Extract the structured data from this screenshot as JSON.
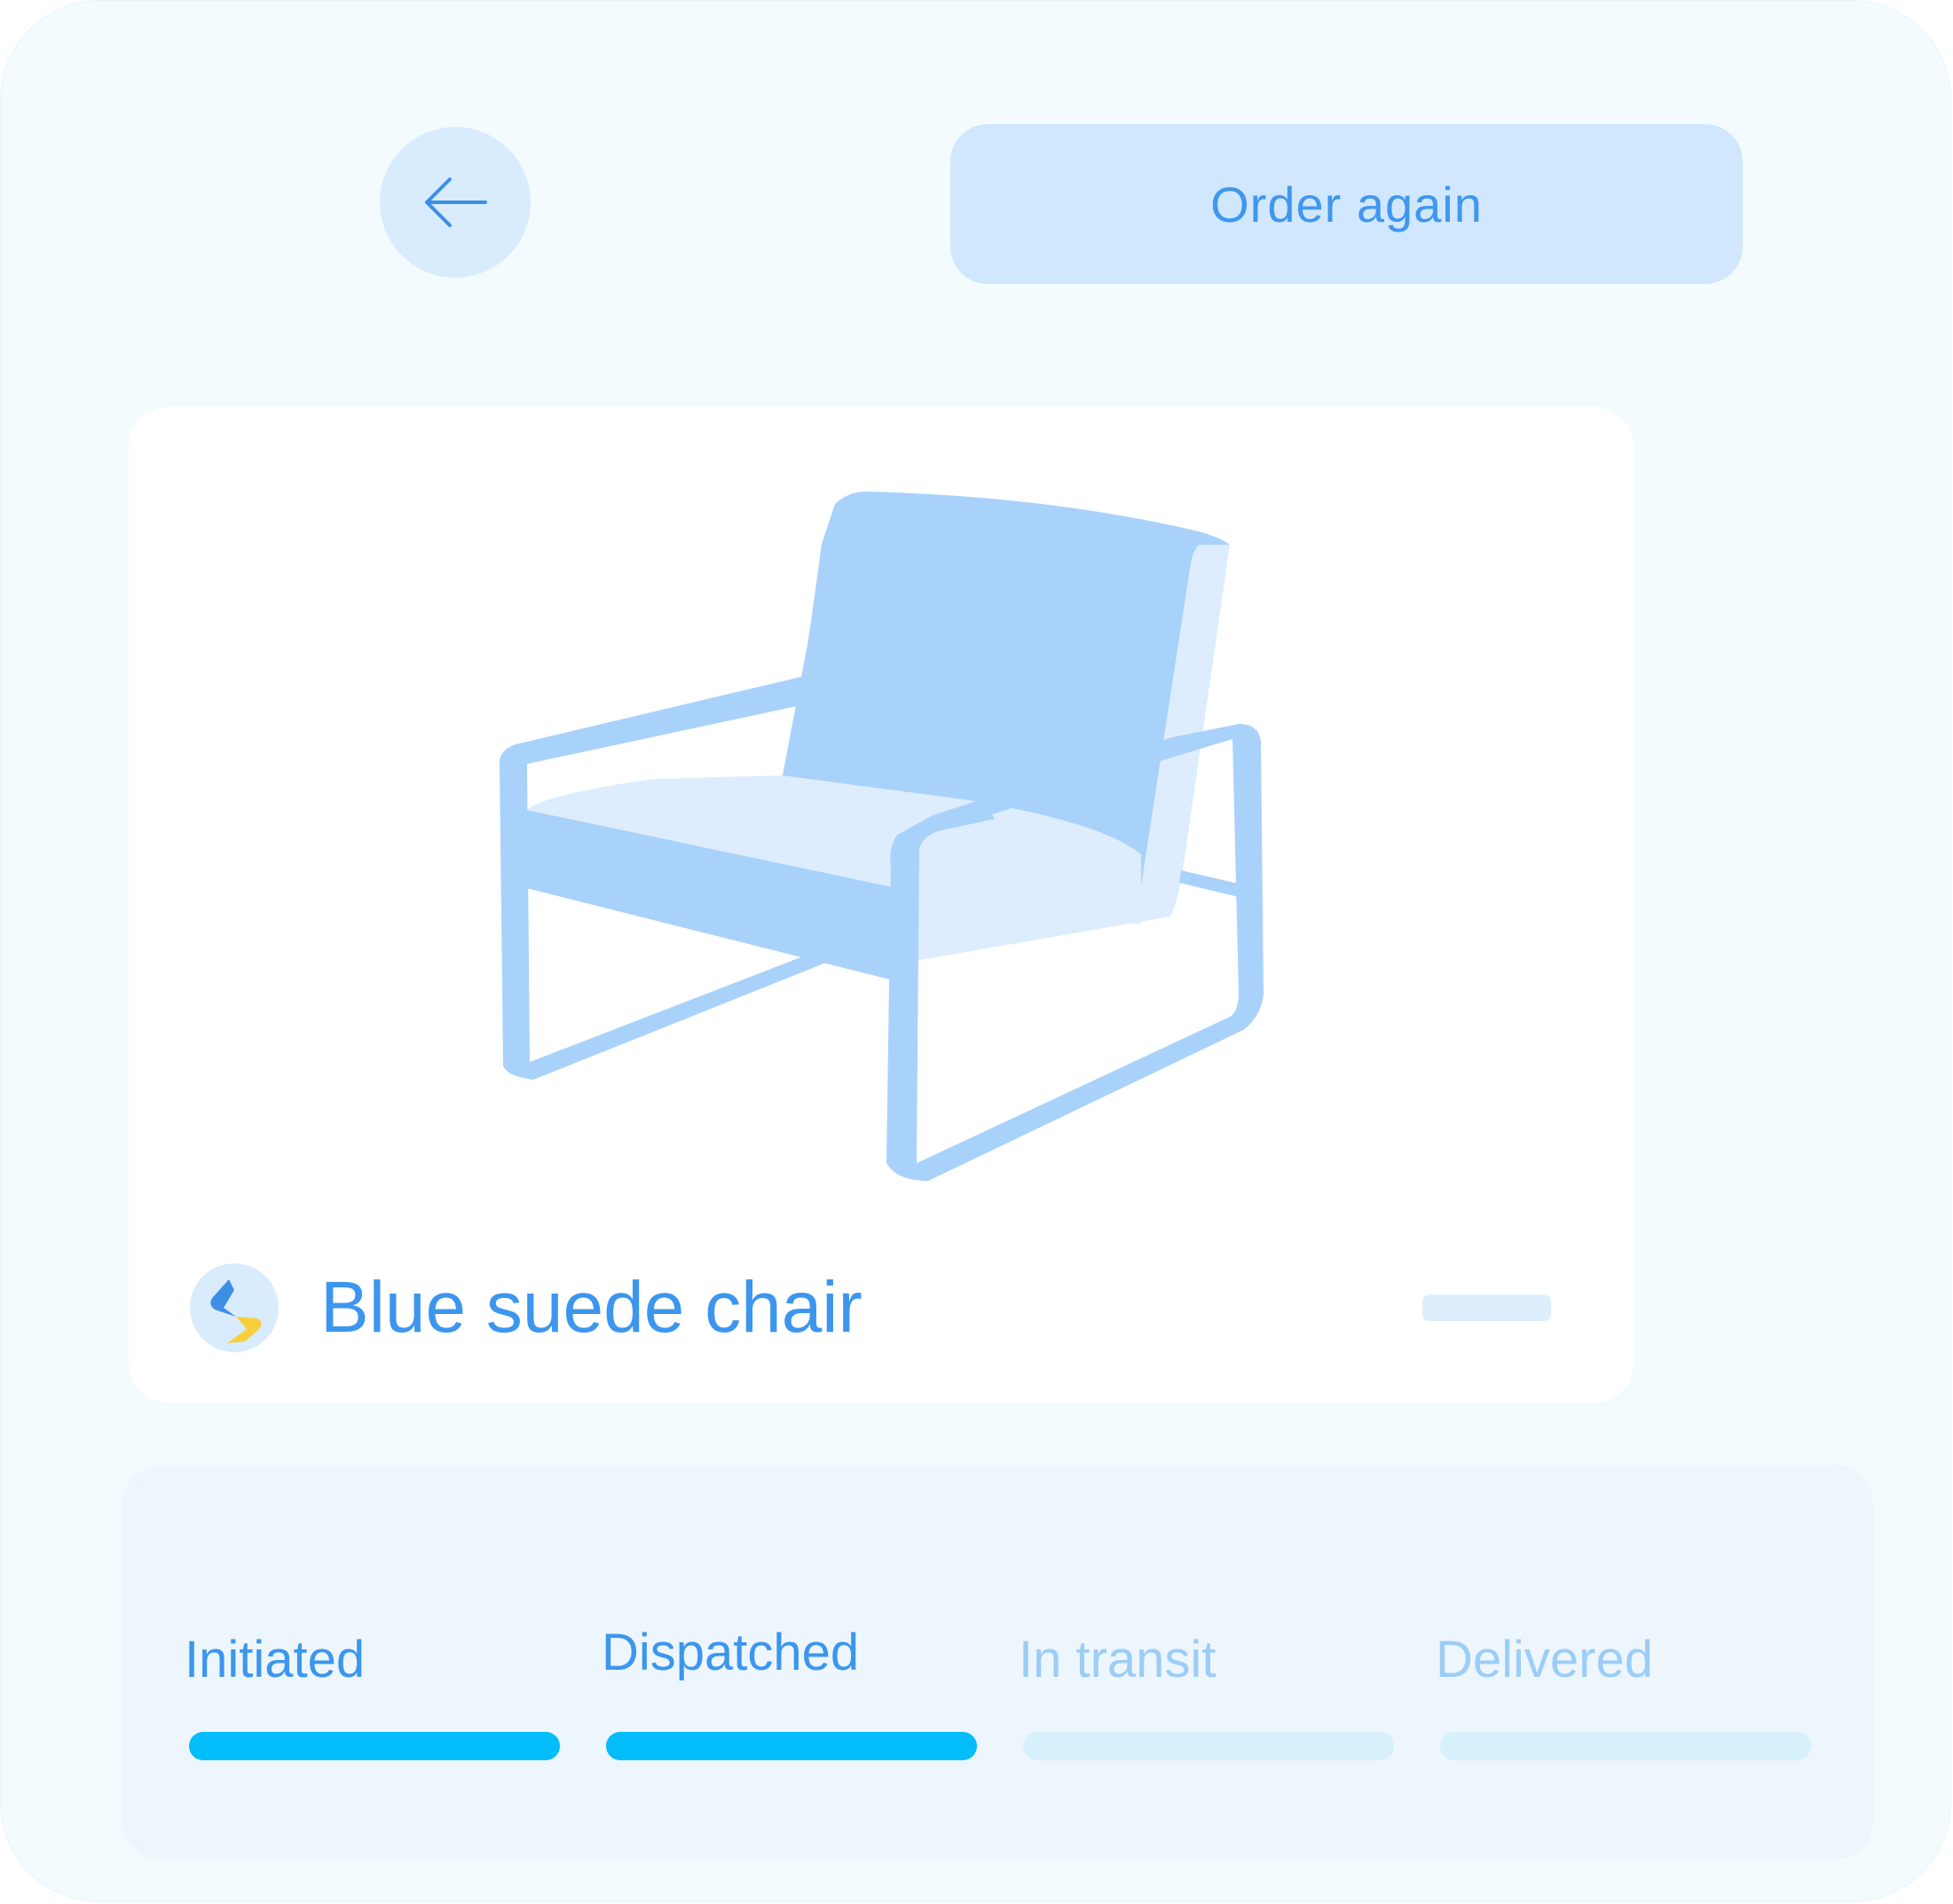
{
  "header": {
    "back_icon": "arrow-left-icon",
    "order_again_label": "Order again"
  },
  "product": {
    "name": "Blue suede chair",
    "image": "blue-chair-illustration",
    "brand_icon": "brand-logo-icon"
  },
  "tracking": {
    "steps": [
      {
        "label": "Initiated",
        "status": "complete"
      },
      {
        "label": "Dispatched",
        "status": "complete"
      },
      {
        "label": "In transit",
        "status": "pending"
      },
      {
        "label": "Delivered",
        "status": "pending"
      }
    ]
  },
  "colors": {
    "accent": "#3c96ee",
    "progress_done": "#02bdf9",
    "progress_pending": "#d6f0fc",
    "background": "#f3fbfe"
  }
}
